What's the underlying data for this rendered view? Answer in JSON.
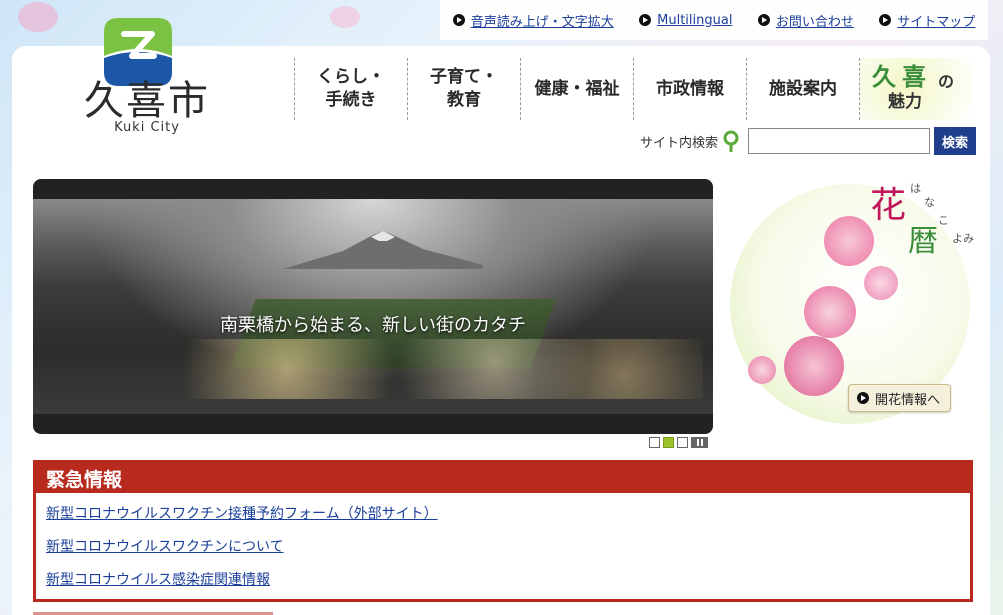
{
  "top_links": [
    {
      "label": "音声読み上げ・文字拡大"
    },
    {
      "label": "Multilingual"
    },
    {
      "label": "お問い合わせ"
    },
    {
      "label": "サイトマップ"
    }
  ],
  "logo": {
    "name": "久喜市",
    "subtitle": "Kuki City"
  },
  "nav": [
    {
      "label": "くらし・\n手続き"
    },
    {
      "label": "子育て・\n教育"
    },
    {
      "label": "健康・福祉"
    },
    {
      "label": "市政情報"
    },
    {
      "label": "施設案内"
    }
  ],
  "nav_charm": {
    "ku": "久",
    "ki": "喜",
    "no": "の",
    "miryoku": "魅力"
  },
  "search": {
    "label": "サイト内検索",
    "placeholder": "",
    "button_label": "検索"
  },
  "slider": {
    "caption": "南栗橋から始まる、新しい街のカタチ",
    "slide_count": 3,
    "active_index": 1
  },
  "banner": {
    "title_hana": "花",
    "title_koyomi": "暦",
    "ruby": [
      "は",
      "な",
      "こ",
      "よみ"
    ],
    "button_label": "開花情報へ"
  },
  "emergency": {
    "title": "緊急情報",
    "items": [
      {
        "label": "新型コロナウイルスワクチン接種予約フォーム（外部サイト）"
      },
      {
        "label": "新型コロナウイルスワクチンについて"
      },
      {
        "label": "新型コロナウイルス感染症関連情報"
      }
    ]
  },
  "colors": {
    "brand_blue": "#1f3f8c",
    "emergency_red": "#b8291e",
    "link_blue": "#1a3f9a",
    "accent_green": "#9cc22a"
  }
}
